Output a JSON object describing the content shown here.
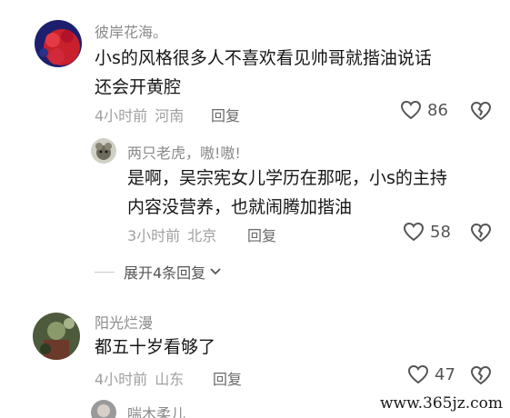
{
  "comments": [
    {
      "username": "彼岸花海。",
      "text_lines": [
        "小s的风格很多人不喜欢看见帅哥就揩油说话",
        "还会开黄腔"
      ],
      "time": "4小时前",
      "location": "河南",
      "reply_label": "回复",
      "likes": "86",
      "replies": [
        {
          "username": "两只老虎，嗷!嗷!",
          "text_lines": [
            "是啊，吴宗宪女儿学历在那呢，小s的主持",
            "内容没营养，也就闹腾加揩油"
          ],
          "time": "3小时前",
          "location": "北京",
          "reply_label": "回复",
          "likes": "58"
        }
      ],
      "expand_label": "展开4条回复"
    },
    {
      "username": "阳光烂漫",
      "text_lines": [
        "都五十岁看够了"
      ],
      "time": "4小时前",
      "location": "山东",
      "reply_label": "回复",
      "likes": "47",
      "replies": [
        {
          "username": "喘木柔儿"
        }
      ]
    }
  ],
  "watermark": "www.365jz.com",
  "colors": {
    "username": "#8a8a8a",
    "meta": "#a0a0a0",
    "text": "#161616",
    "icon": "#555555"
  },
  "icons": [
    "heart-outline-icon",
    "broken-heart-icon",
    "chevron-down-icon"
  ]
}
